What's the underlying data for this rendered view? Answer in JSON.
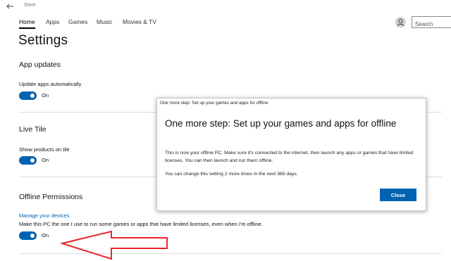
{
  "window": {
    "title": "Store"
  },
  "nav": {
    "items": [
      {
        "label": "Home",
        "active": true
      },
      {
        "label": "Apps"
      },
      {
        "label": "Games"
      },
      {
        "label": "Music"
      },
      {
        "label": "Movies & TV"
      }
    ]
  },
  "search": {
    "placeholder": "Search"
  },
  "page": {
    "title": "Settings"
  },
  "sections": {
    "app_updates": {
      "title": "App updates",
      "setting_label": "Update apps automatically",
      "toggle_state": "On"
    },
    "live_tile": {
      "title": "Live Tile",
      "setting_label": "Show products on tile",
      "toggle_state": "On"
    },
    "offline_permissions": {
      "title": "Offline Permissions",
      "link": "Manage your devices",
      "description": "Make this PC the one I use to run some games or apps that have limited licenses, even when I'm offline.",
      "toggle_state": "On"
    }
  },
  "dialog": {
    "titlebar": "One more step: Set up your games and apps for offline",
    "heading": "One more step: Set up your games and apps for offline",
    "body": "This is now your offline PC. Make sure it's connected to the internet, then launch any apps or games that have limited licenses. You can then launch and run them offline.",
    "body2": "You can change this setting 2 more times in the next 365 days.",
    "close_label": "Close"
  },
  "colors": {
    "accent": "#0063b1",
    "annotation_arrow": "#e8262a"
  }
}
